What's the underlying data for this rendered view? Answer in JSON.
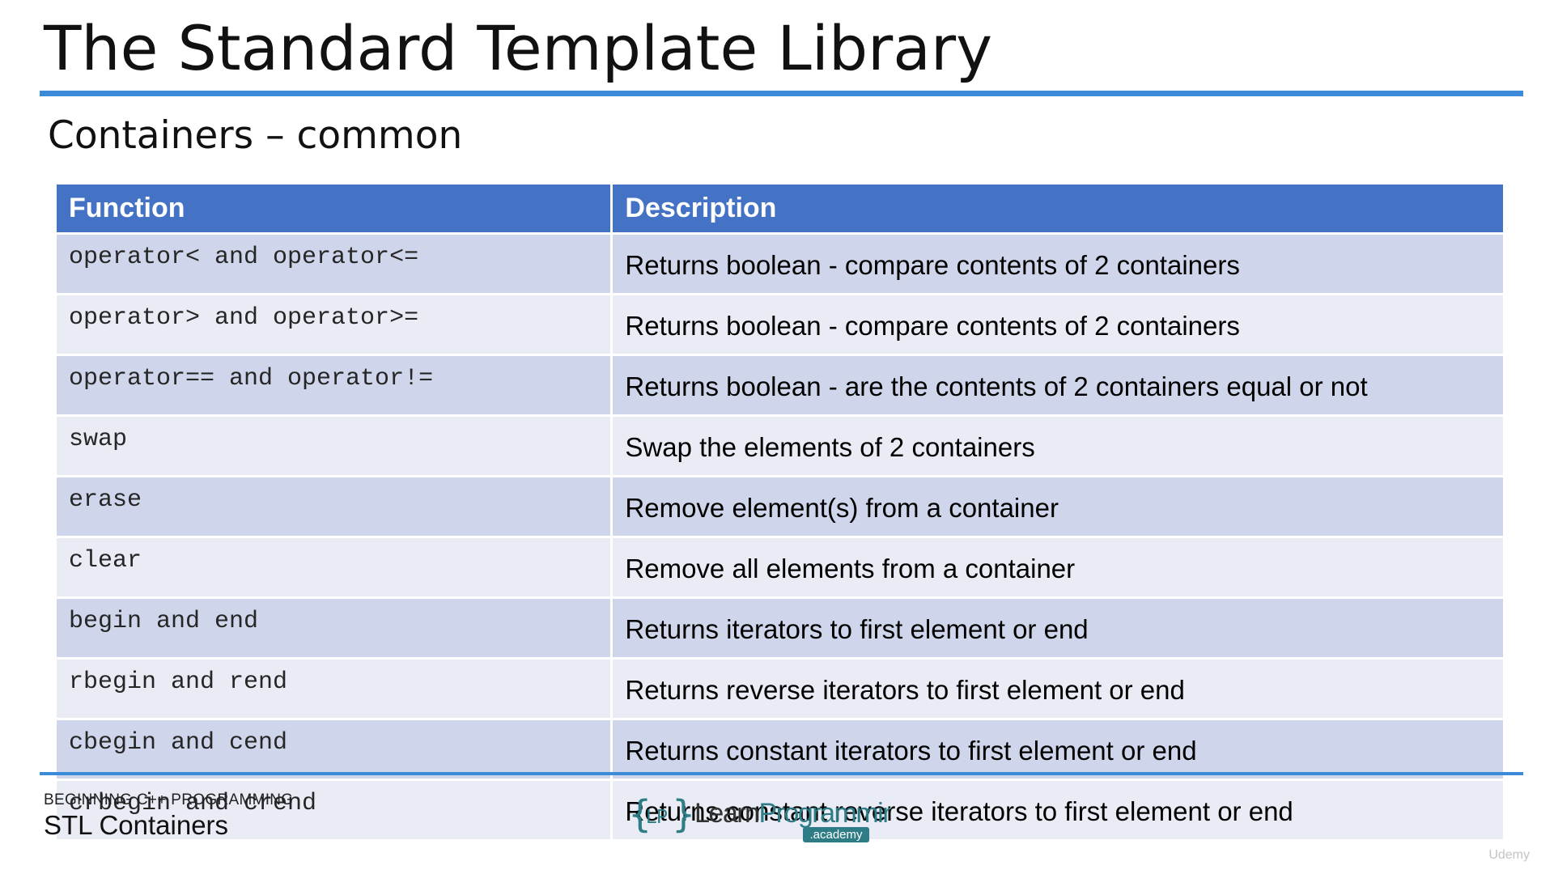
{
  "slide": {
    "title": "The Standard Template Library",
    "subtitle": "Containers – common"
  },
  "table": {
    "headers": {
      "function": "Function",
      "description": "Description"
    },
    "rows": [
      {
        "function": "operator< and operator<=",
        "description": "Returns boolean - compare contents of 2 containers"
      },
      {
        "function": "operator> and operator>=",
        "description": "Returns boolean - compare contents of 2 containers"
      },
      {
        "function": "operator== and operator!=",
        "description": "Returns boolean - are the contents of 2 containers equal or not"
      },
      {
        "function": "swap",
        "description": "Swap the elements of 2 containers"
      },
      {
        "function": "erase",
        "description": "Remove element(s) from a container"
      },
      {
        "function": "clear",
        "description": "Remove all elements from a container"
      },
      {
        "function": "begin and end",
        "description": "Returns iterators to first element or end"
      },
      {
        "function": "rbegin and rend",
        "description": "Returns reverse iterators to first element or end"
      },
      {
        "function": "cbegin and cend",
        "description": "Returns constant iterators to first element or end"
      },
      {
        "function": "crbegin and crend",
        "description": "Returns constant reverse iterators to first element or end"
      }
    ]
  },
  "footer": {
    "course": "BEGINNING C++ PROGRAMMING",
    "lecture": "STL Containers",
    "logo": {
      "brace_text": "LP",
      "name_learn": "Learn",
      "name_programming": "Programming",
      "badge": ".academy"
    },
    "watermark": "Udemy"
  },
  "colors": {
    "accent_rule": "#3b8bd9",
    "header_bg": "#4472c4",
    "row_dark": "#cfd5ea",
    "row_light": "#e9ebf5",
    "logo_teal": "#2e7d86"
  }
}
